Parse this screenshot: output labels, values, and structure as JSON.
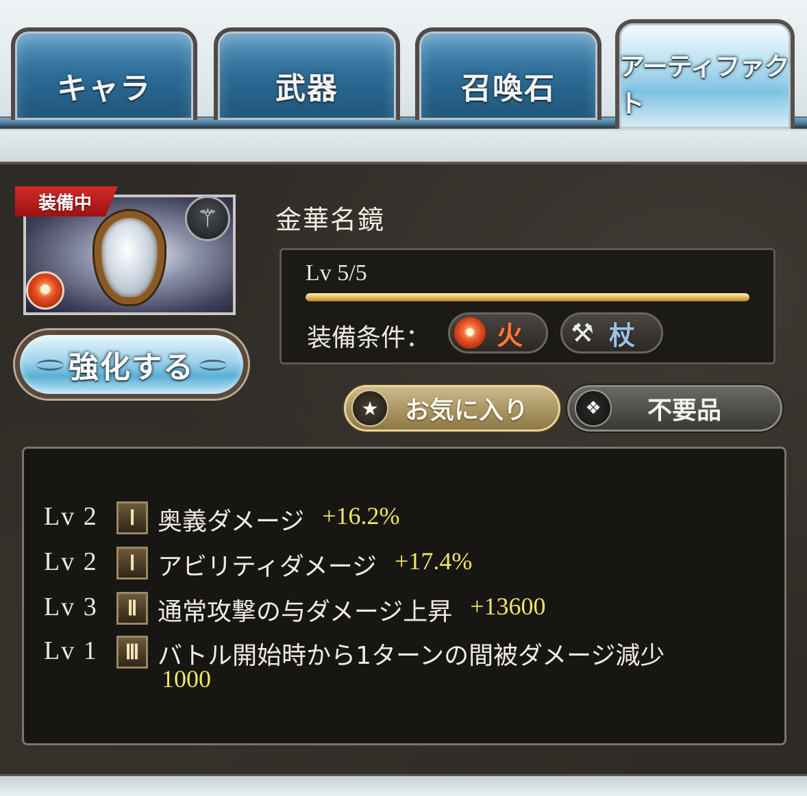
{
  "tabs": [
    {
      "label": "キャラ",
      "active": false
    },
    {
      "label": "武器",
      "active": false
    },
    {
      "label": "召喚石",
      "active": false
    },
    {
      "label": "アーティファクト",
      "active": true
    }
  ],
  "item": {
    "equipped_badge": "装備中",
    "name": "金華名鏡",
    "element_icon": "fire-icon",
    "weapon_type_icon": "staff-icon"
  },
  "enhance_button": "強化する",
  "level": {
    "text": "Lv 5/5",
    "current": 5,
    "max": 5
  },
  "requirements": {
    "label": "装備条件：",
    "element": "火",
    "weapon": "杖"
  },
  "actions": {
    "favorite": "お気に入り",
    "junk": "不要品"
  },
  "skills": [
    {
      "lv": "Lv 2",
      "tier": "Ⅰ",
      "name": "奥義ダメージ",
      "value": "+16.2%"
    },
    {
      "lv": "Lv 2",
      "tier": "Ⅰ",
      "name": "アビリティダメージ",
      "value": "+17.4%"
    },
    {
      "lv": "Lv 3",
      "tier": "Ⅱ",
      "name": "通常攻撃の与ダメージ上昇",
      "value": "+13600"
    },
    {
      "lv": "Lv 1",
      "tier": "Ⅲ",
      "name": "バトル開始時から1ターンの間被ダメージ減少",
      "value": "1000"
    }
  ],
  "colors": {
    "accent_gold": "#f1e566",
    "tab_blue": "#2f6f99",
    "badge_red": "#d22a2a"
  }
}
